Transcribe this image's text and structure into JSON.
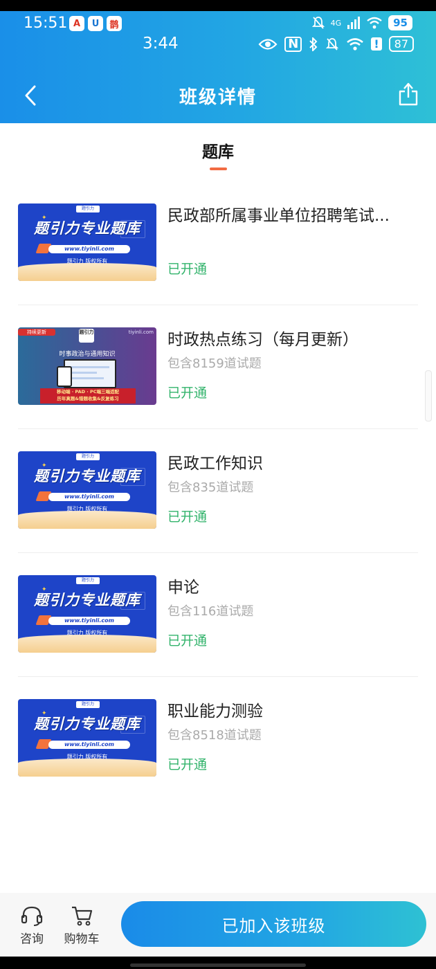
{
  "status_outer": {
    "time": "15:51",
    "app_badges": [
      "A",
      "U",
      "鹊"
    ],
    "network": "4G",
    "battery": "95"
  },
  "status_inner": {
    "time": "3:44",
    "nfc": "N",
    "alert": "!",
    "battery": "87"
  },
  "nav": {
    "title": "班级详情"
  },
  "tab": {
    "label": "题库"
  },
  "banner": {
    "main_text": "题引力专业题库",
    "url": "www.tiyinli.com",
    "copyright": "题引力 版权所有",
    "logo": "题引力"
  },
  "banner_purple": {
    "tag": "持续更新",
    "logo": "题引力",
    "site": "tiyinli.com",
    "headline": "时事政治与通用知识",
    "promo_line1": "移动端 · PAD · PC端三端适配",
    "promo_line2": "历年真题&错题收集&反复练习"
  },
  "items": [
    {
      "title": "民政部所属事业单位招聘笔试...",
      "count": "",
      "status": "已开通",
      "thumb": "blue"
    },
    {
      "title": "时政热点练习（每月更新）",
      "count": "包含8159道试题",
      "status": "已开通",
      "thumb": "purple"
    },
    {
      "title": "民政工作知识",
      "count": "包含835道试题",
      "status": "已开通",
      "thumb": "blue"
    },
    {
      "title": "申论",
      "count": "包含116道试题",
      "status": "已开通",
      "thumb": "blue"
    },
    {
      "title": "职业能力测验",
      "count": "包含8518道试题",
      "status": "已开通",
      "thumb": "blue"
    }
  ],
  "bottom": {
    "consult_label": "咨询",
    "cart_label": "购物车",
    "join_label": "已加入该班级"
  },
  "colors": {
    "header_start": "#1a8fe8",
    "header_end": "#2ec0d6",
    "status_green": "#32b36b",
    "tab_underline": "#f26b43"
  }
}
